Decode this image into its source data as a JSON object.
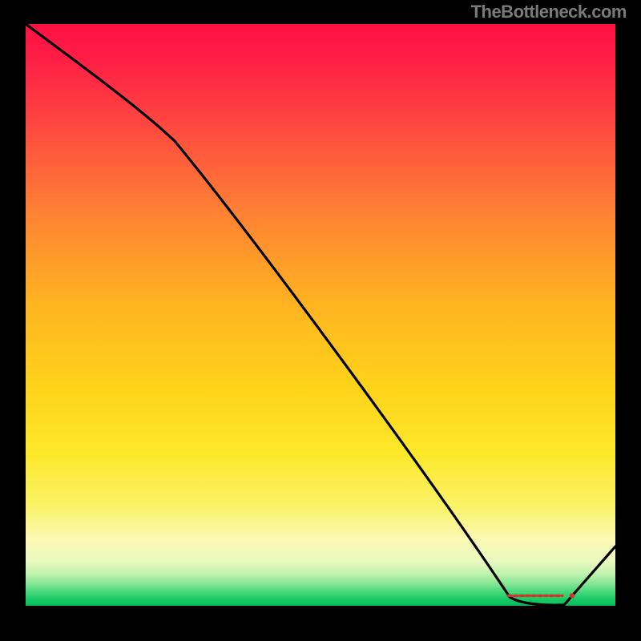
{
  "attribution": "TheBottleneck.com",
  "chart_data": {
    "type": "line",
    "title": "",
    "xlabel": "",
    "ylabel": "",
    "xlim": [
      0,
      100
    ],
    "ylim": [
      0,
      100
    ],
    "x": [
      0,
      25,
      82,
      86,
      92,
      100
    ],
    "values": [
      100,
      80,
      2,
      0,
      0,
      10
    ],
    "grid": false,
    "legend": false,
    "background_gradient": {
      "top": "#FF1744",
      "mid": "#FFEB3B",
      "bottom": "#00E676"
    }
  }
}
